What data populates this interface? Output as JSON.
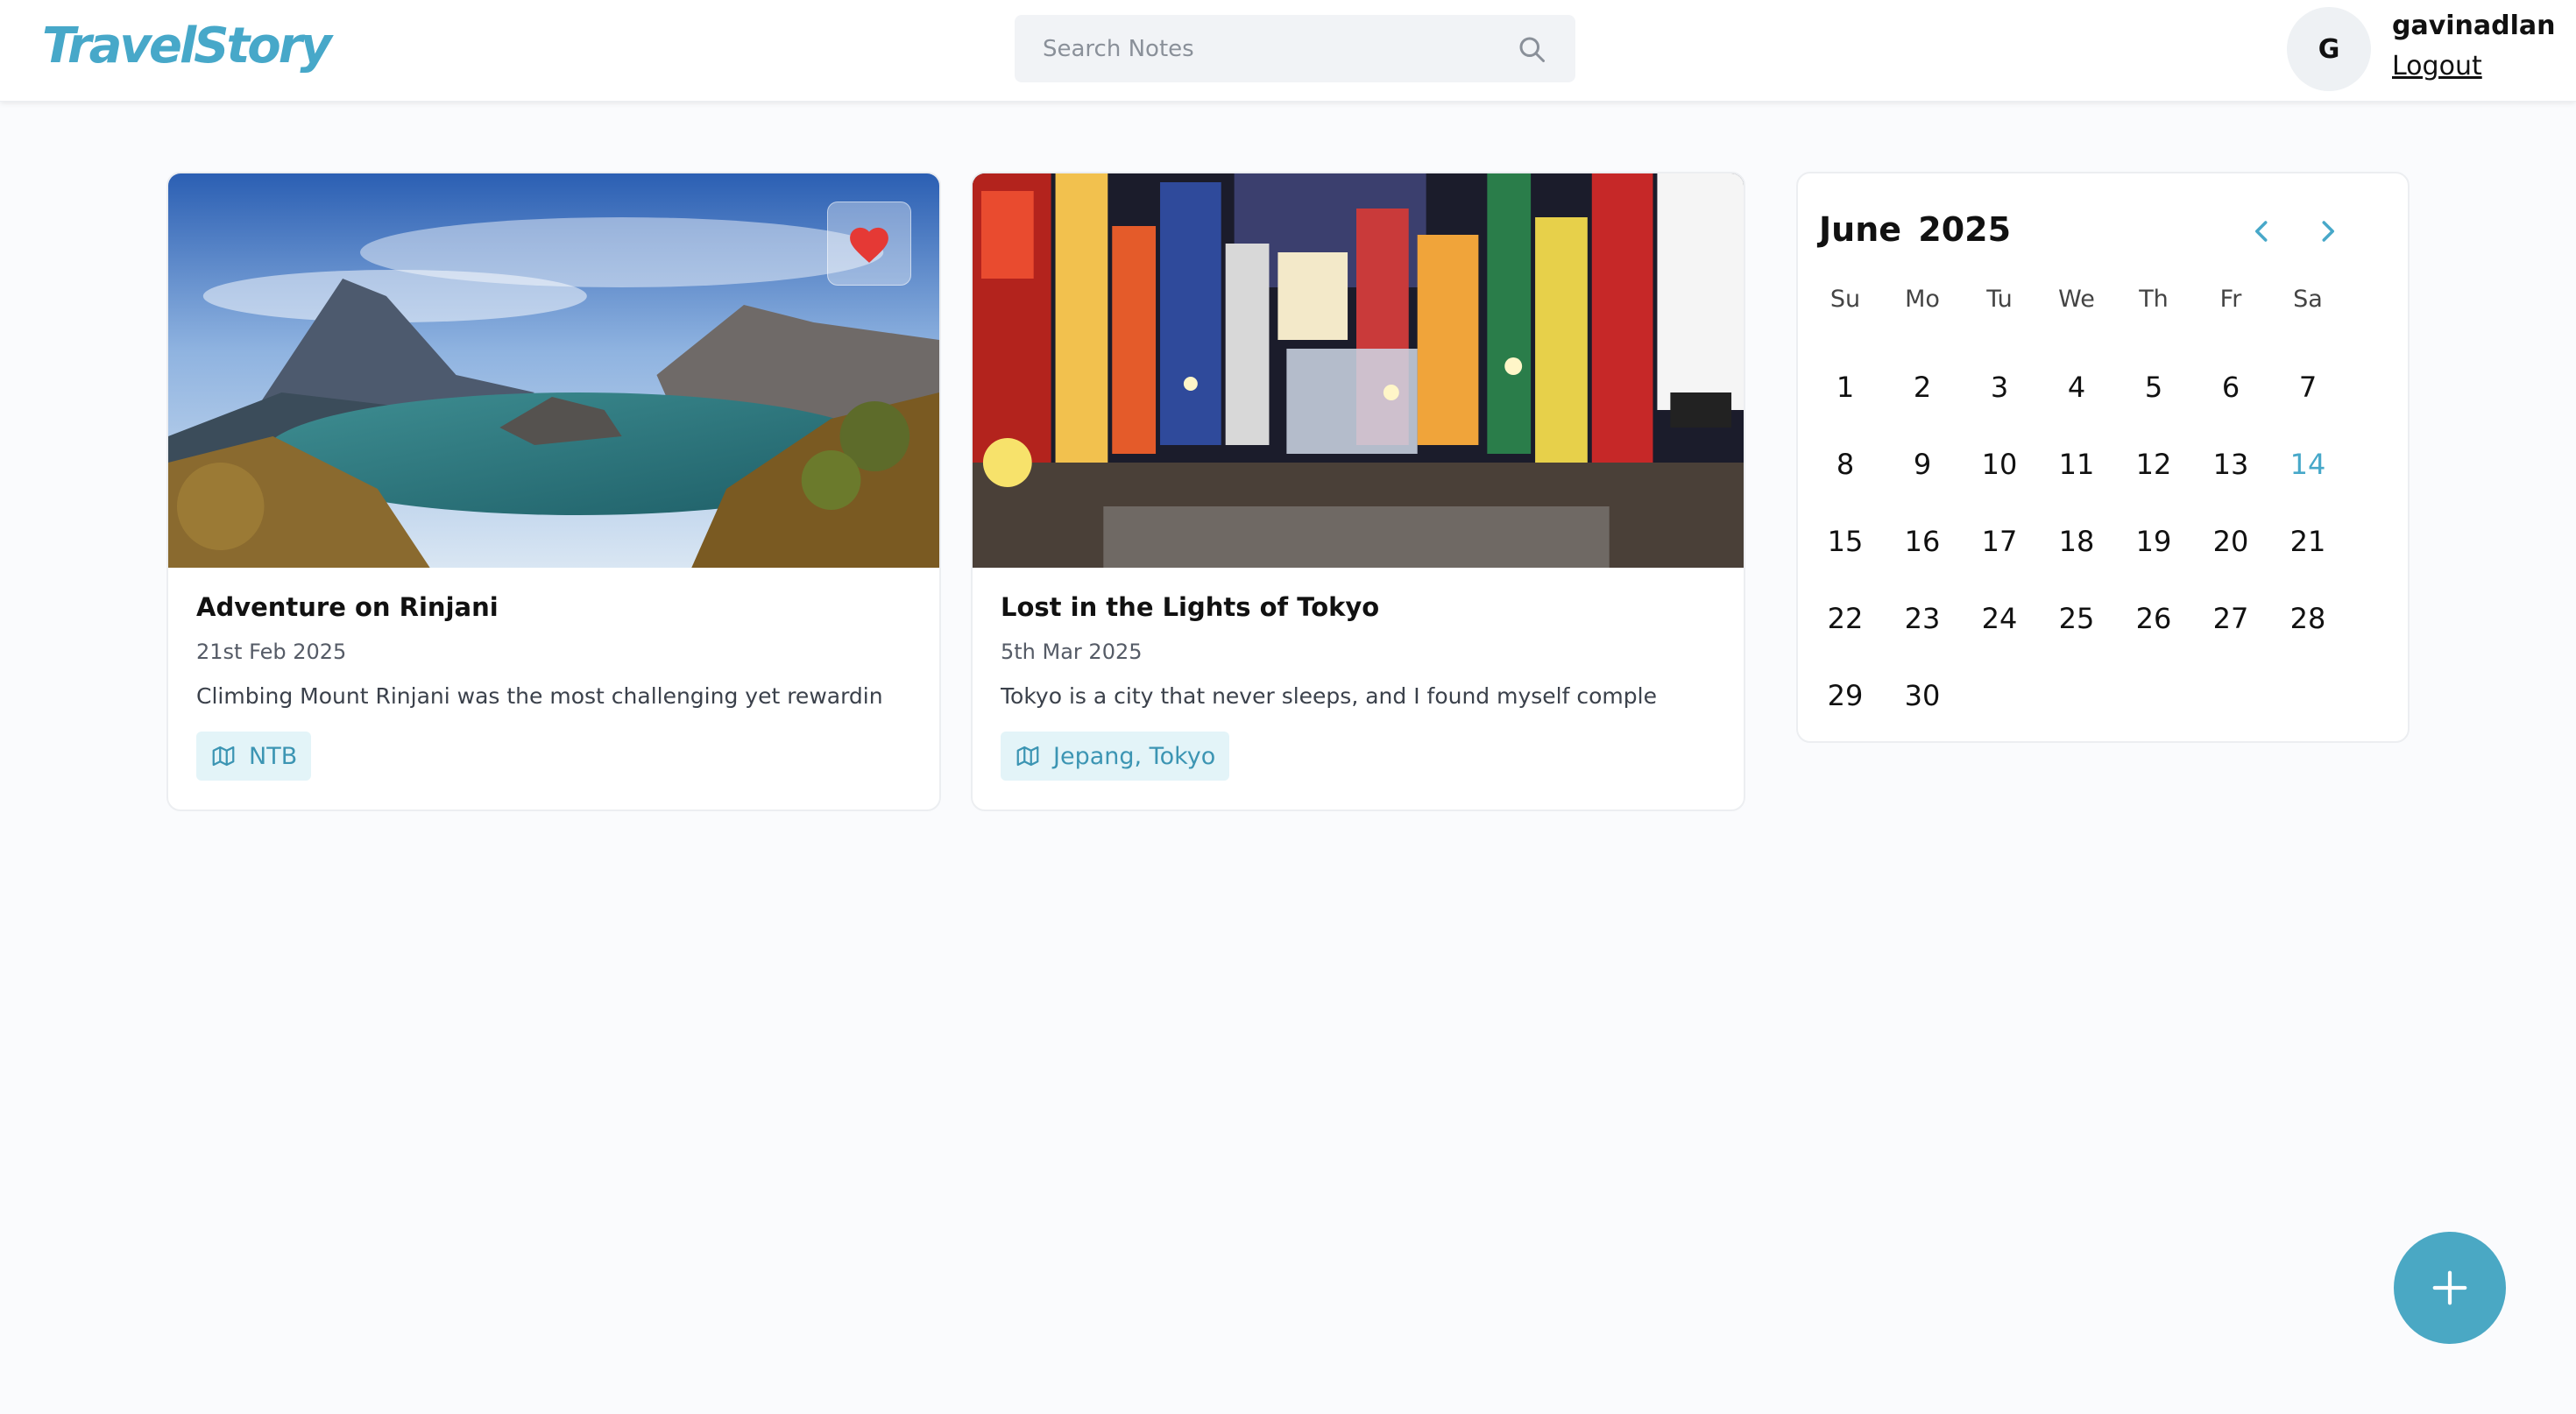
{
  "header": {
    "logo": "TravelStory",
    "search": {
      "placeholder": "Search Notes",
      "value": ""
    },
    "user": {
      "initial": "G",
      "name": "gavinadlan",
      "logout_label": "Logout"
    }
  },
  "stories": [
    {
      "title": "Adventure on Rinjani",
      "date": "21st Feb 2025",
      "excerpt": "Climbing Mount Rinjani was the most challenging yet rewardin",
      "location": "NTB",
      "favorite": true,
      "image": "mountain crater lake landscape"
    },
    {
      "title": "Lost in the Lights of Tokyo",
      "date": "5th Mar 2025",
      "excerpt": "Tokyo is a city that never sleeps, and I found myself comple",
      "location": "Jepang, Tokyo",
      "favorite": false,
      "image": "neon-lit street at night"
    }
  ],
  "calendar": {
    "month": "June",
    "year": "2025",
    "weekdays": [
      "Su",
      "Mo",
      "Tu",
      "We",
      "Th",
      "Fr",
      "Sa"
    ],
    "days": [
      "1",
      "2",
      "3",
      "4",
      "5",
      "6",
      "7",
      "8",
      "9",
      "10",
      "11",
      "12",
      "13",
      "14",
      "15",
      "16",
      "17",
      "18",
      "19",
      "20",
      "21",
      "22",
      "23",
      "24",
      "25",
      "26",
      "27",
      "28",
      "29",
      "30"
    ],
    "today": "14"
  },
  "colors": {
    "accent": "#47a8c9",
    "heart": "#e53935",
    "tag_bg": "#e3f4f8",
    "fab": "#4aa8c4"
  },
  "icons": {
    "search": "search-icon",
    "favorite": "heart-icon",
    "location": "map-icon",
    "prev": "chevron-left-icon",
    "next": "chevron-right-icon",
    "add": "plus-icon"
  }
}
